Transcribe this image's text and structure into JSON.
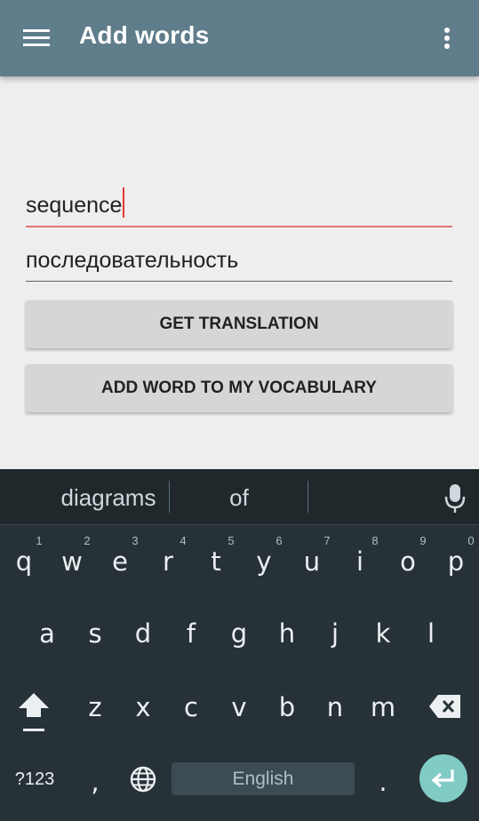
{
  "app_bar": {
    "title": "Add words"
  },
  "form": {
    "word_value": "sequence",
    "translation_value": "последовательность",
    "get_translation_label": "GET TRANSLATION",
    "add_word_label": "ADD WORD TO MY VOCABULARY"
  },
  "keyboard": {
    "suggestions": [
      "diagrams",
      "of"
    ],
    "row1": [
      "q",
      "w",
      "e",
      "r",
      "t",
      "y",
      "u",
      "i",
      "o",
      "p"
    ],
    "row1_hints": [
      "1",
      "2",
      "3",
      "4",
      "5",
      "6",
      "7",
      "8",
      "9",
      "0"
    ],
    "row2": [
      "a",
      "s",
      "d",
      "f",
      "g",
      "h",
      "j",
      "k",
      "l"
    ],
    "row3": [
      "z",
      "x",
      "c",
      "v",
      "b",
      "n",
      "m"
    ],
    "symbols_label": "?123",
    "comma": ",",
    "period": ".",
    "space_label": "English"
  },
  "colors": {
    "app_bar": "#607d8b",
    "accent_underline": "#e57373",
    "keyboard_bg": "#263238",
    "enter_key": "#80cbc4"
  }
}
